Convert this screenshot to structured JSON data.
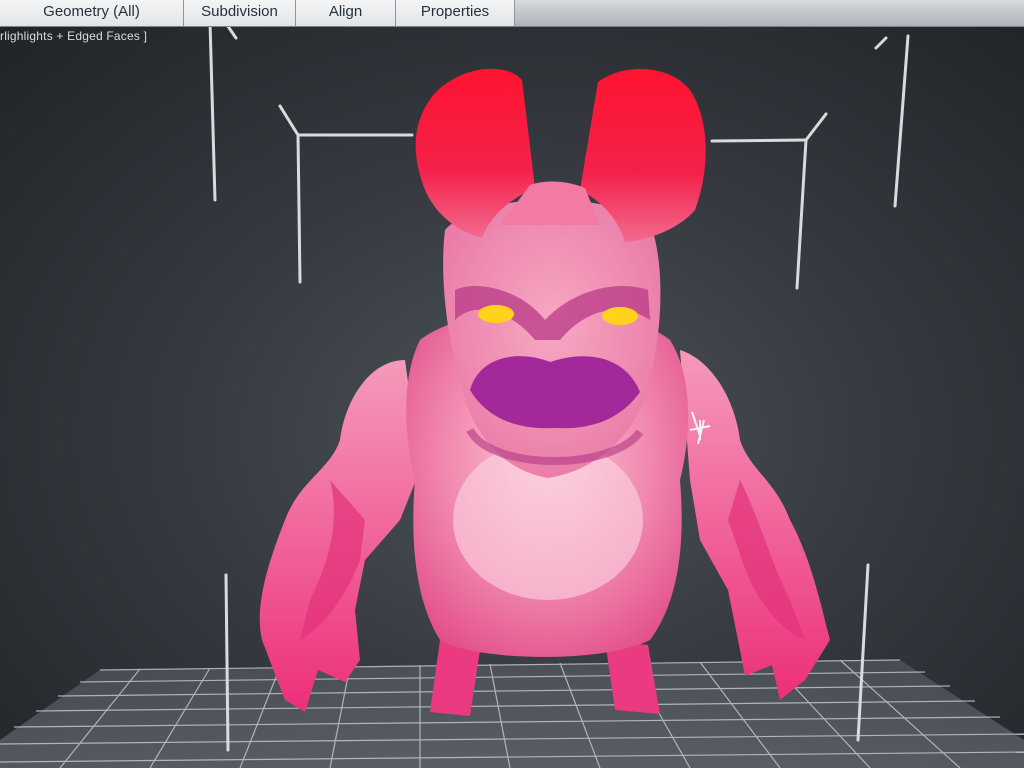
{
  "toolbar": {
    "tabs": [
      {
        "label": "Geometry (All)"
      },
      {
        "label": "Subdivision"
      },
      {
        "label": "Align"
      },
      {
        "label": "Properties"
      }
    ]
  },
  "viewport": {
    "shading_label": "rlighlights + Edged Faces ]"
  },
  "colors": {
    "background": "#2a2d32",
    "model_skin": "#ee6f9c",
    "horns": "#f2193d",
    "eyes": "#ffd21e",
    "grid": "#c9ccd2"
  },
  "icons": {
    "cursor": "cursor-icon"
  }
}
